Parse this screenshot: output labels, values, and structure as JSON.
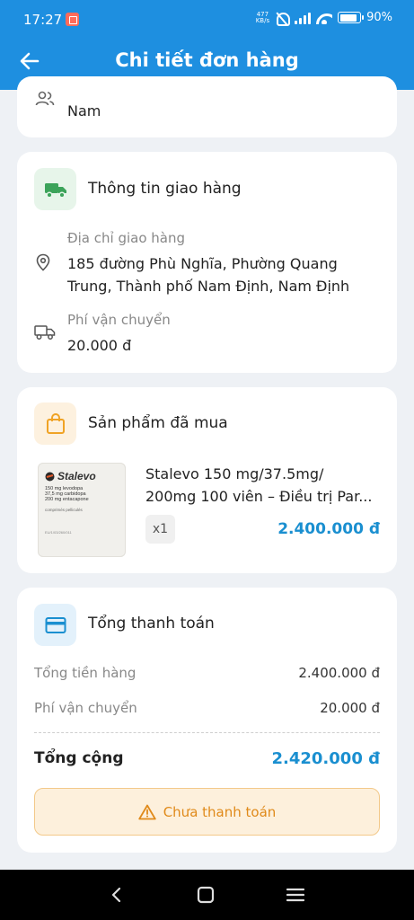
{
  "status": {
    "time": "17:27",
    "net_speed_top": "477",
    "net_speed_bottom": "KB/s",
    "battery": "90%"
  },
  "header": {
    "title": "Chi tiết đơn hàng"
  },
  "customer": {
    "gender": "Nam"
  },
  "delivery": {
    "title": "Thông tin giao hàng",
    "address_label": "Địa chỉ giao hàng",
    "address_line1": "185 đường Phù Nghĩa, Phường Quang",
    "address_line2": "Trung, Thành phố Nam Định, Nam Định",
    "fee_label": "Phí vận chuyển",
    "fee_value": "20.000 đ"
  },
  "products": {
    "title": "Sản phẩm đã mua",
    "items": [
      {
        "name_line1": "Stalevo 150 mg/37.5mg/",
        "name_line2": "200mg 100 viên – Điều trị Par...",
        "quantity": "x1",
        "price": "2.400.000 đ",
        "image_brand": "Stalevo",
        "image_lines": [
          "150 mg levodopa",
          "37,5 mg carbidopa",
          "200 mg entacapone"
        ],
        "image_form": "comprimés pelliculés",
        "image_code": "EU/1/03/260/011"
      }
    ]
  },
  "payment": {
    "title": "Tổng thanh toán",
    "subtotal_label": "Tổng tiền hàng",
    "subtotal_value": "2.400.000 đ",
    "shipping_label": "Phí vận chuyển",
    "shipping_value": "20.000 đ",
    "total_label": "Tổng cộng",
    "total_value": "2.420.000 đ",
    "status_label": "Chưa thanh toán"
  },
  "colors": {
    "primary": "#1e8fe0",
    "price": "#1a8fd0",
    "warning": "#e08a1a",
    "delivery_icon_bg": "#e7f5ea",
    "delivery_icon": "#3ca35a",
    "product_icon_bg": "#fdf1df",
    "product_icon": "#f0a325",
    "payment_icon_bg": "#e3f1fb",
    "payment_icon": "#1a8fd0"
  }
}
